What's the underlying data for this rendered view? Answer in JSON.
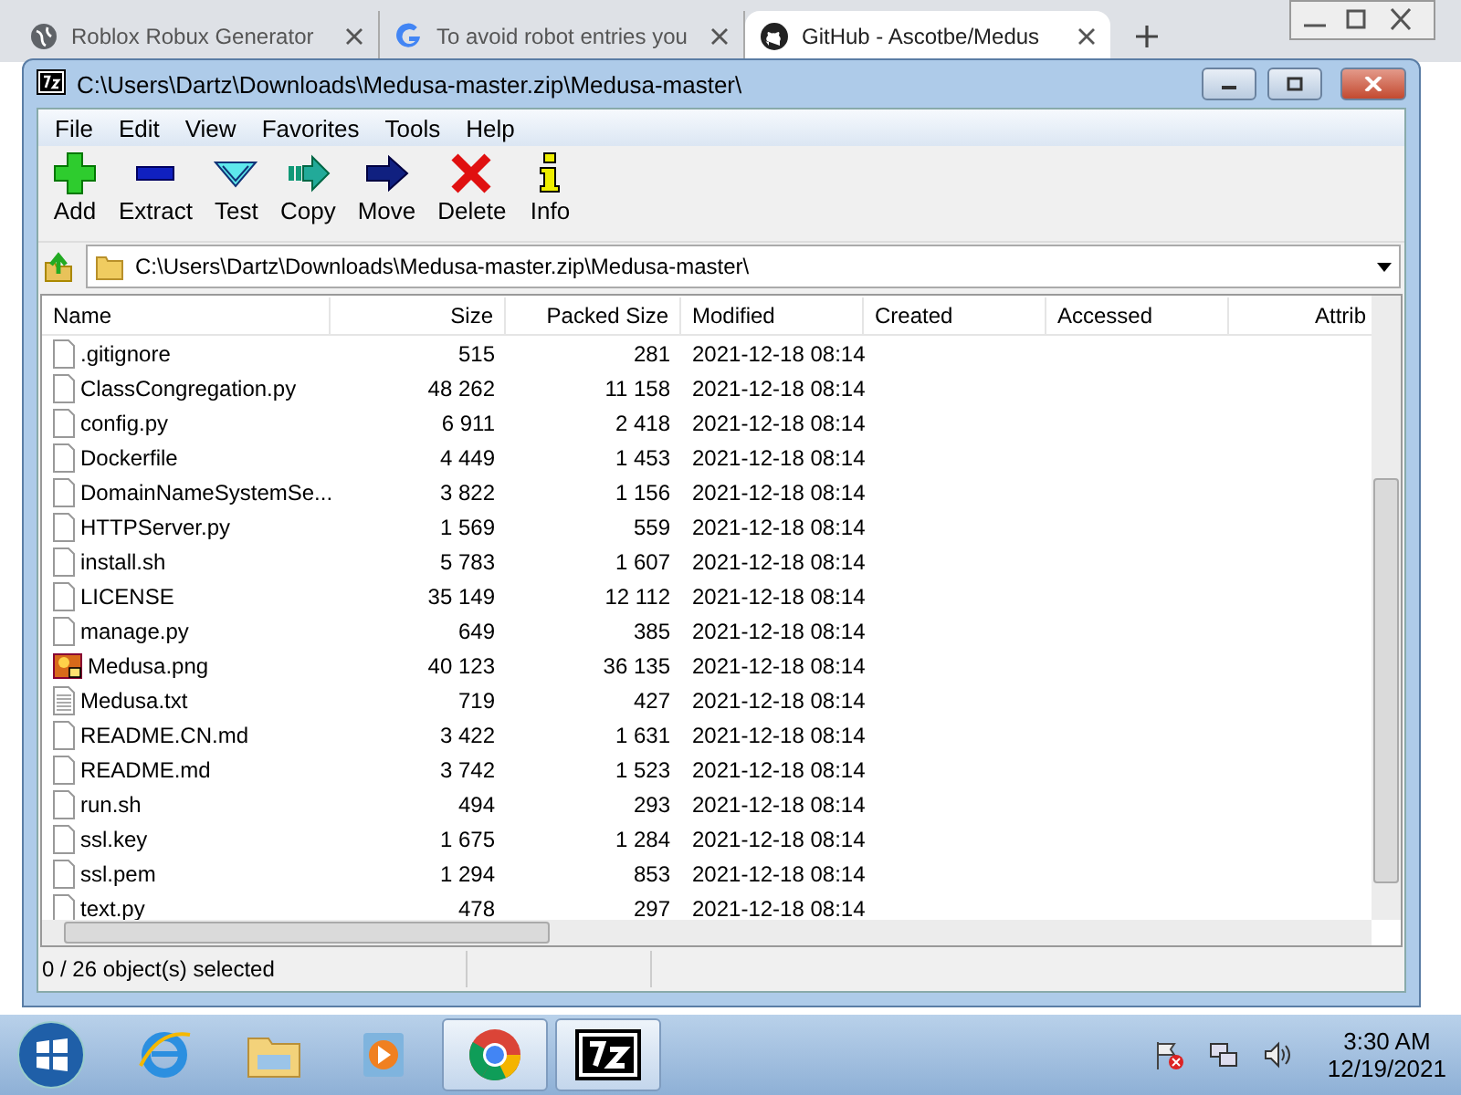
{
  "browser_tabs": [
    {
      "title": "Roblox Robux Generator",
      "kind": "globe",
      "selected": false
    },
    {
      "title": "To avoid robot entries you",
      "kind": "google",
      "selected": false
    },
    {
      "title": "GitHub - Ascotbe/Medus",
      "kind": "github",
      "selected": true
    }
  ],
  "window": {
    "title": "C:\\Users\\Dartz\\Downloads\\Medusa-master.zip\\Medusa-master\\"
  },
  "menu": [
    "File",
    "Edit",
    "View",
    "Favorites",
    "Tools",
    "Help"
  ],
  "toolbar": [
    {
      "label": "Add",
      "kind": "add"
    },
    {
      "label": "Extract",
      "kind": "extract"
    },
    {
      "label": "Test",
      "kind": "test"
    },
    {
      "label": "Copy",
      "kind": "copy"
    },
    {
      "label": "Move",
      "kind": "move"
    },
    {
      "label": "Delete",
      "kind": "delete"
    },
    {
      "label": "Info",
      "kind": "info"
    }
  ],
  "address": {
    "value": "C:\\Users\\Dartz\\Downloads\\Medusa-master.zip\\Medusa-master\\"
  },
  "table": {
    "columns": [
      "Name",
      "Size",
      "Packed Size",
      "Modified",
      "Created",
      "Accessed",
      "Attrib"
    ],
    "rows": [
      {
        "kind": "file",
        "name": ".gitignore",
        "size": "515",
        "packed": "281",
        "modified": "2021-12-18 08:14"
      },
      {
        "kind": "file",
        "name": "ClassCongregation.py",
        "size": "48 262",
        "packed": "11 158",
        "modified": "2021-12-18 08:14"
      },
      {
        "kind": "file",
        "name": "config.py",
        "size": "6 911",
        "packed": "2 418",
        "modified": "2021-12-18 08:14"
      },
      {
        "kind": "file",
        "name": "Dockerfile",
        "size": "4 449",
        "packed": "1 453",
        "modified": "2021-12-18 08:14"
      },
      {
        "kind": "file",
        "name": "DomainNameSystemSe...",
        "size": "3 822",
        "packed": "1 156",
        "modified": "2021-12-18 08:14"
      },
      {
        "kind": "file",
        "name": "HTTPServer.py",
        "size": "1 569",
        "packed": "559",
        "modified": "2021-12-18 08:14"
      },
      {
        "kind": "file",
        "name": "install.sh",
        "size": "5 783",
        "packed": "1 607",
        "modified": "2021-12-18 08:14"
      },
      {
        "kind": "file",
        "name": "LICENSE",
        "size": "35 149",
        "packed": "12 112",
        "modified": "2021-12-18 08:14"
      },
      {
        "kind": "file",
        "name": "manage.py",
        "size": "649",
        "packed": "385",
        "modified": "2021-12-18 08:14"
      },
      {
        "kind": "image",
        "name": "Medusa.png",
        "size": "40 123",
        "packed": "36 135",
        "modified": "2021-12-18 08:14"
      },
      {
        "kind": "text",
        "name": "Medusa.txt",
        "size": "719",
        "packed": "427",
        "modified": "2021-12-18 08:14"
      },
      {
        "kind": "file",
        "name": "README.CN.md",
        "size": "3 422",
        "packed": "1 631",
        "modified": "2021-12-18 08:14"
      },
      {
        "kind": "file",
        "name": "README.md",
        "size": "3 742",
        "packed": "1 523",
        "modified": "2021-12-18 08:14"
      },
      {
        "kind": "file",
        "name": "run.sh",
        "size": "494",
        "packed": "293",
        "modified": "2021-12-18 08:14"
      },
      {
        "kind": "file",
        "name": "ssl.key",
        "size": "1 675",
        "packed": "1 284",
        "modified": "2021-12-18 08:14"
      },
      {
        "kind": "file",
        "name": "ssl.pem",
        "size": "1 294",
        "packed": "853",
        "modified": "2021-12-18 08:14"
      },
      {
        "kind": "file",
        "name": "text.py",
        "size": "478",
        "packed": "297",
        "modified": "2021-12-18 08:14"
      }
    ]
  },
  "status_bar": "0 / 26 object(s) selected",
  "taskbar": {
    "apps": [
      {
        "kind": "ie",
        "active": false
      },
      {
        "kind": "explorer",
        "active": false
      },
      {
        "kind": "media",
        "active": false
      },
      {
        "kind": "chrome",
        "active": true
      },
      {
        "kind": "archive",
        "active": true
      }
    ],
    "time": "3:30 AM",
    "date": "12/19/2021"
  }
}
